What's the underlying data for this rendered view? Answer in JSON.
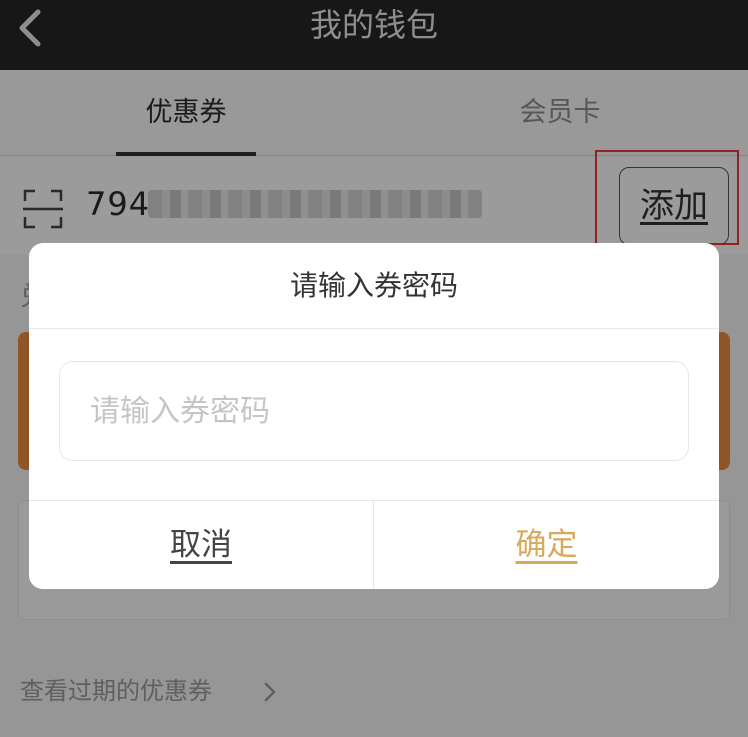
{
  "navbar": {
    "title": "我的钱包"
  },
  "tabs": [
    {
      "label": "优惠券",
      "active": true
    },
    {
      "label": "会员卡",
      "active": false
    }
  ],
  "code_row": {
    "code_prefix": "794",
    "add_label": "添加"
  },
  "background": {
    "partial_label": "兑"
  },
  "expired_link": {
    "label": "查看过期的优惠券"
  },
  "dialog": {
    "title": "请输入券密码",
    "input_placeholder": "请输入券密码",
    "input_value": "",
    "cancel_label": "取消",
    "confirm_label": "确定"
  },
  "colors": {
    "accent": "#d8a95c",
    "highlight": "#e53935",
    "navbar": "#262626",
    "orange_card": "#e9893a"
  }
}
